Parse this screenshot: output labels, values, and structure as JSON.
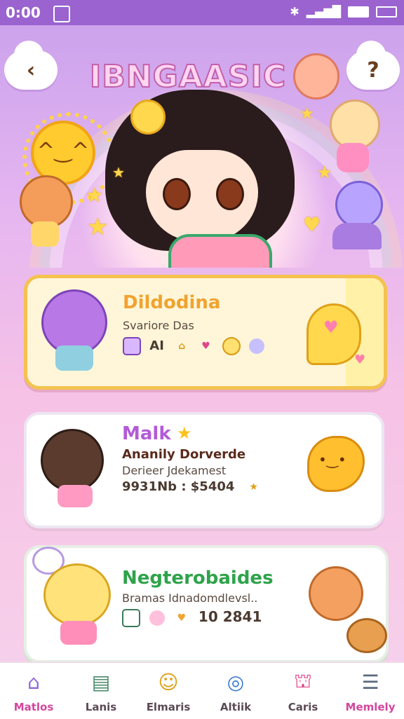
{
  "status_bar": {
    "time": "0:00"
  },
  "header": {
    "logo_text": "IBNGAASIC",
    "back_glyph": "‹",
    "help_glyph": "?"
  },
  "cards": [
    {
      "title": "Dildodina",
      "subtitle": "Svariore Das",
      "meta_text": "AI",
      "title_color": "#f0a330"
    },
    {
      "title": "Malk",
      "headline": "Ananily Dorverde",
      "subtitle": "Derieer Jdekamest",
      "meta_text": "9931Nb : $5404",
      "title_color": "#b25bd8"
    },
    {
      "title": "Negterobaides",
      "subtitle": "Bramas Idnadomdlevsl..",
      "meta_text": "10 2841",
      "title_color": "#2fa34b",
      "title_color2": "#e0478a"
    }
  ],
  "bottom_nav": [
    {
      "label": "Matlos",
      "icon": "home-icon",
      "active": true
    },
    {
      "label": "Lanis",
      "icon": "cards-icon",
      "active": false
    },
    {
      "label": "Elmaris",
      "icon": "friend-icon",
      "active": false
    },
    {
      "label": "Altiik",
      "icon": "compass-icon",
      "active": false
    },
    {
      "label": "Caris",
      "icon": "shop-icon",
      "active": false
    },
    {
      "label": "Memlely",
      "icon": "menu-icon",
      "active": false
    }
  ],
  "colors": {
    "accent": "#9a63cf",
    "active_nav": "#d2479c"
  }
}
